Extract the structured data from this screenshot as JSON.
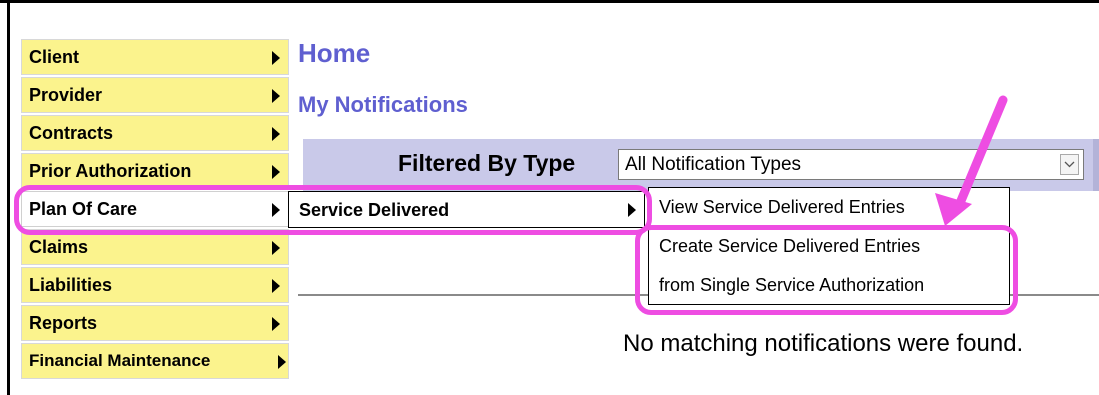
{
  "nav_menu": {
    "items": [
      {
        "label": "Client"
      },
      {
        "label": "Provider"
      },
      {
        "label": "Contracts"
      },
      {
        "label": "Prior Authorization"
      },
      {
        "label": "Plan Of Care"
      },
      {
        "label": "Claims"
      },
      {
        "label": "Liabilities"
      },
      {
        "label": "Reports"
      },
      {
        "label": "Financial Maintenance"
      }
    ]
  },
  "submenu": {
    "label": "Service Delivered",
    "items": [
      {
        "label": "View Service Delivered Entries"
      },
      {
        "label": "Create Service Delivered Entries"
      },
      {
        "label": "from Single Service Authorization"
      }
    ]
  },
  "page": {
    "title": "Home",
    "section_title": "My Notifications",
    "filter_label": "Filtered By Type",
    "filter_value": "All Notification Types",
    "empty_message": "No matching notifications were found."
  },
  "annotation": {
    "color": "#ee4de2"
  }
}
